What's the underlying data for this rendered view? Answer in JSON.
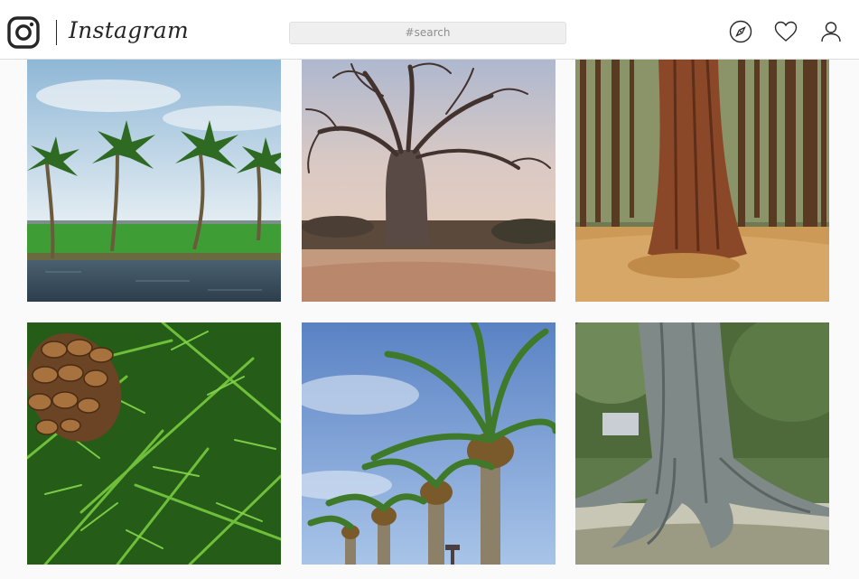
{
  "header": {
    "brand_name": "Instagram",
    "search_placeholder": "#search",
    "icons": [
      "instagram-logo-icon",
      "compass-icon",
      "heart-icon",
      "profile-icon"
    ]
  },
  "feed": {
    "tiles": [
      {
        "subject": "coconut palms by backwater canal"
      },
      {
        "subject": "baobab tree"
      },
      {
        "subject": "redwood forest"
      },
      {
        "subject": "pine cone on pine branches"
      },
      {
        "subject": "date palms under blue sky"
      },
      {
        "subject": "tree with large buttress roots"
      }
    ]
  },
  "colors": {
    "header_bg": "#ffffff",
    "page_bg": "#fafafa",
    "border": "#dbdbdb",
    "search_bg": "#efefef",
    "text_dark": "#262626",
    "text_muted": "#8e8e8e"
  }
}
